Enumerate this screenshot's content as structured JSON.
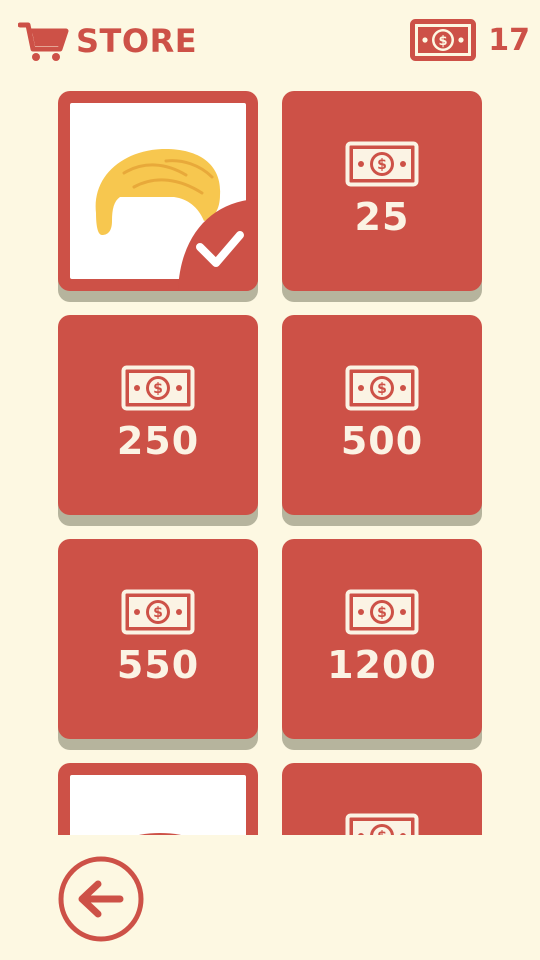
{
  "header": {
    "title": "STORE",
    "cart_icon": "shopping-cart-icon",
    "balance_icon": "banknote-icon",
    "balance": "17"
  },
  "store": {
    "items": [
      {
        "type": "owned",
        "icon": "yellow-hair-icon",
        "badge_icon": "check-icon"
      },
      {
        "type": "price",
        "icon": "banknote-icon",
        "price": "25"
      },
      {
        "type": "price",
        "icon": "banknote-icon",
        "price": "250"
      },
      {
        "type": "price",
        "icon": "banknote-icon",
        "price": "500"
      },
      {
        "type": "price",
        "icon": "banknote-icon",
        "price": "550"
      },
      {
        "type": "price",
        "icon": "banknote-icon",
        "price": "1200"
      },
      {
        "type": "preview",
        "icon": "red-hat-icon"
      },
      {
        "type": "price",
        "icon": "banknote-icon"
      }
    ]
  },
  "footer": {
    "back_icon": "back-arrow-icon"
  },
  "colors": {
    "background": "#fdf8e2",
    "accent": "#cd5147",
    "tile_shadow": "#b6b49d",
    "hair": "#f7c74f",
    "text_light": "#fbf3e4"
  }
}
